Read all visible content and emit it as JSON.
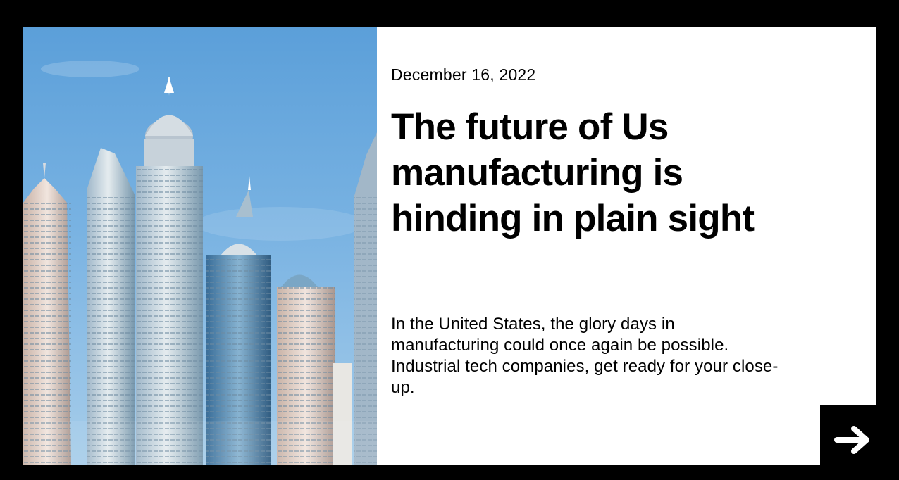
{
  "article": {
    "date": "December 16, 2022",
    "title_lines": [
      "The future of Us",
      "manufacturing is",
      "hinding in plain sight"
    ],
    "description": "In the United States, the glory days in manufacturing could once again be possible. Industrial tech companies, get ready for your close-up.",
    "image_alt": "City skyline with skyscrapers",
    "next_icon": "arrow-right-icon"
  },
  "colors": {
    "page_background": "#000000",
    "card_background": "#ffffff",
    "text": "#000000",
    "sky": "#5b9fd9"
  }
}
